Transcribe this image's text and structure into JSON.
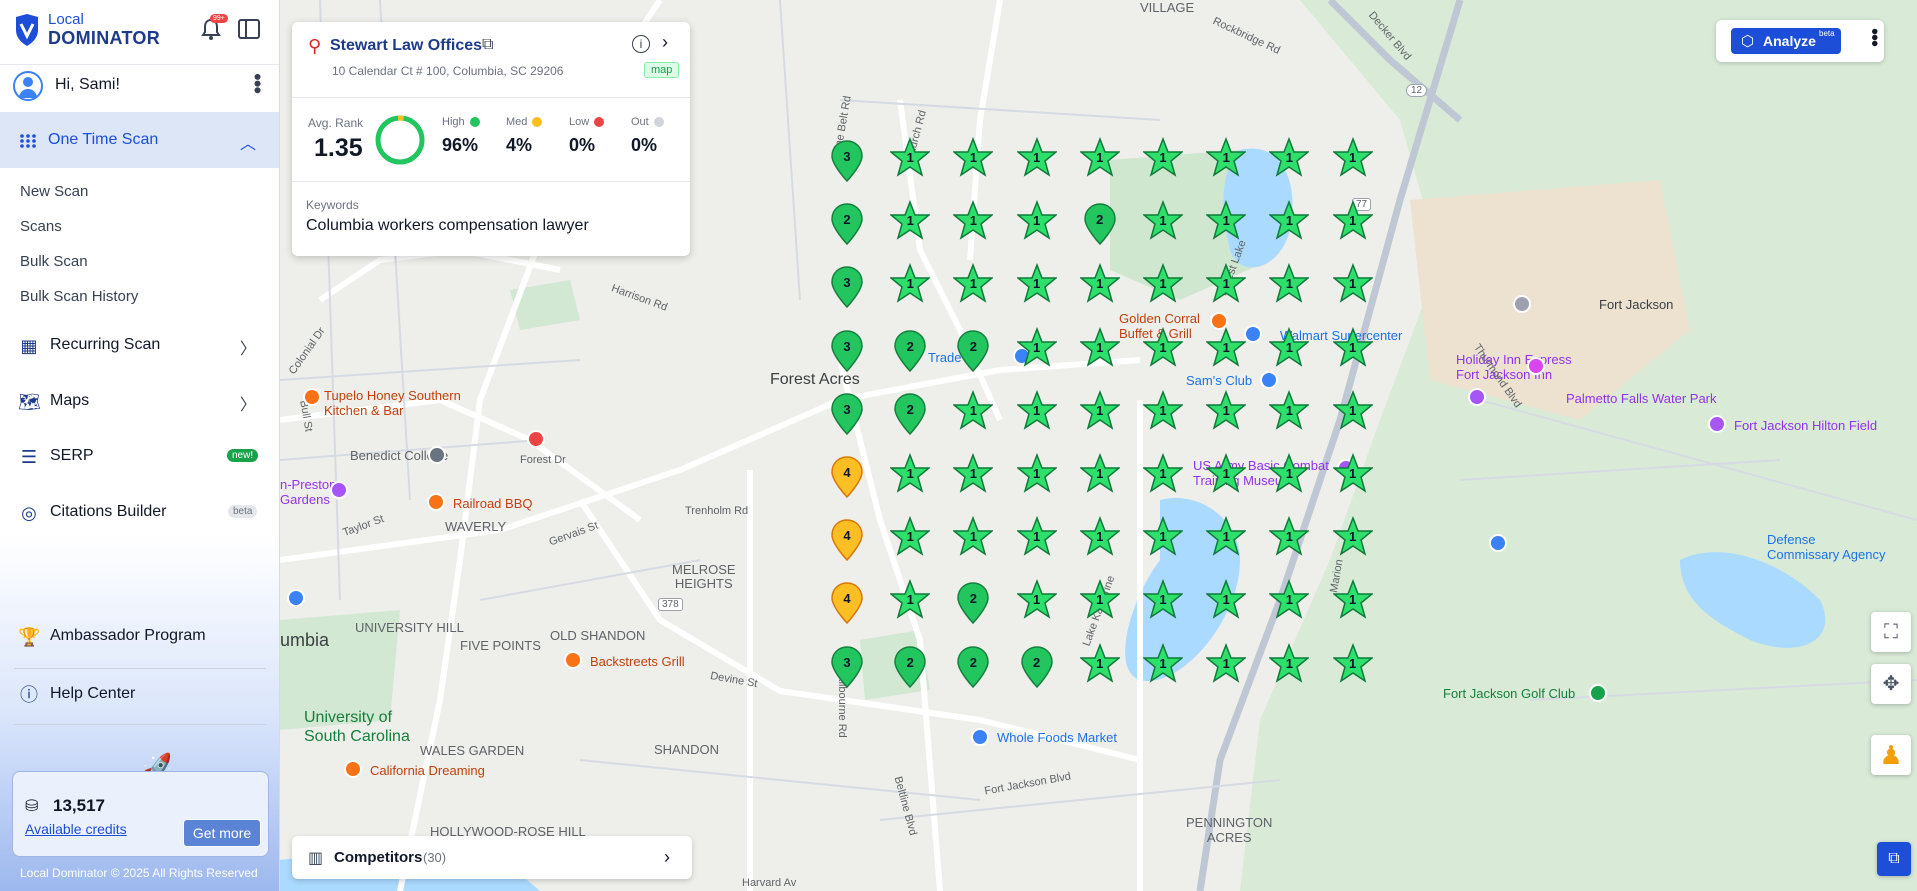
{
  "brand": {
    "line1": "Local",
    "line2": "DOMINATOR",
    "notif_badge": "99+"
  },
  "user": {
    "greeting": "Hi, Sami!"
  },
  "nav": {
    "one_time_scan": "One Time Scan",
    "sub_items": [
      "New Scan",
      "Scans",
      "Bulk Scan",
      "Bulk Scan History"
    ],
    "recurring_scan": "Recurring Scan",
    "maps": "Maps",
    "serp": "SERP",
    "serp_badge": "new!",
    "citations": "Citations Builder",
    "citations_badge": "beta",
    "ambassador": "Ambassador Program",
    "help": "Help Center"
  },
  "credits": {
    "amount": "13,517",
    "label": "Available credits",
    "button": "Get more"
  },
  "footer": {
    "copyright": "Local Dominator © 2025 All Rights Reserved"
  },
  "card": {
    "business": "Stewart Law Offices",
    "address": "10 Calendar Ct # 100, Columbia, SC 29206",
    "tag": "map",
    "avg_label": "Avg. Rank",
    "avg_value": "1.35",
    "stats": [
      {
        "label": "High",
        "value": "96%",
        "color": "#22c55e"
      },
      {
        "label": "Med",
        "value": "4%",
        "color": "#fbbf24"
      },
      {
        "label": "Low",
        "value": "0%",
        "color": "#ef4444"
      },
      {
        "label": "Out",
        "value": "0%",
        "color": "#d1d5db"
      }
    ],
    "keywords_label": "Keywords",
    "keyword": "Columbia workers compensation lawyer"
  },
  "competitors": {
    "label": "Competitors",
    "count": "(30)"
  },
  "analyze": {
    "label": "Analyze",
    "badge": "beta"
  },
  "grid": {
    "rows": [
      [
        "3",
        "1*",
        "1*",
        "1*",
        "1*",
        "1*",
        "1*",
        "1*",
        "1*"
      ],
      [
        "2",
        "1*",
        "1*",
        "1*",
        "2",
        "1*",
        "1*",
        "1*",
        "1*"
      ],
      [
        "3",
        "1*",
        "1*",
        "1*",
        "1*",
        "1*",
        "1*",
        "1*",
        "1*"
      ],
      [
        "3",
        "2",
        "2",
        "1*",
        "1*",
        "1*",
        "1*",
        "1*",
        "1*"
      ],
      [
        "3",
        "2",
        "1*",
        "1*",
        "1*",
        "1*",
        "1*",
        "1*",
        "1*"
      ],
      [
        "4",
        "1*",
        "1*",
        "1*",
        "1*",
        "1*",
        "1*",
        "1*",
        "1*"
      ],
      [
        "4",
        "1*",
        "1*",
        "1*",
        "1*",
        "1*",
        "1*",
        "1*",
        "1*"
      ],
      [
        "4",
        "1*",
        "2",
        "1*",
        "1*",
        "1*",
        "1*",
        "1*",
        "1*"
      ],
      [
        "3",
        "2",
        "2",
        "2",
        "1*",
        "1*",
        "1*",
        "1*",
        "1*"
      ]
    ]
  },
  "map_labels": {
    "village": "VILLAGE",
    "forest_acres": "Forest Acres",
    "waverly": "WAVERLY",
    "melrose": "MELROSE\nHEIGHTS",
    "university_hill": "UNIVERSITY HILL",
    "five_points": "FIVE POINTS",
    "old_shandon": "OLD SHANDON",
    "columbia": "umbia",
    "usc": "University of\nSouth Carolina",
    "wales_garden": "WALES GARDEN",
    "shandon": "SHANDON",
    "hollywood_rose_hill": "HOLLYWOOD-ROSE HILL",
    "pennington_acres": "PENNINGTON\nACRES",
    "fort_jackson": "Fort Jackson",
    "holiday_inn": "Holiday Inn Express\nFort Jackson Inn",
    "palmetto_falls": "Palmetto Falls Water Park",
    "fort_jackson_hilton": "Fort Jackson Hilton Field",
    "defense_commissary": "Defense\nCommissary Agency",
    "fort_jackson_golf": "Fort Jackson Golf Club",
    "walmart": "Walmart Supercenter",
    "sams_club": "Sam's Club",
    "golden_corral": "Golden Corral\nBuffet & Grill",
    "us_army": "US Army Basic Combat\nTraining Museum",
    "tupelo": "Tupelo Honey Southern\nKitchen & Bar",
    "benedict": "Benedict College",
    "railroad_bbq": "Railroad BBQ",
    "preston_gardens": "n-Preston\nGardens",
    "backstreets": "Backstreets Grill",
    "whole_foods": "Whole Foods Market",
    "california_dreaming": "California Dreaming",
    "trader": "Trade",
    "forest_dr": "Forest Dr",
    "trenholm_rd": "Trenholm Rd",
    "harrison_rd": "Harrison Rd",
    "gervais_st": "Gervais St",
    "devine_st": "Devine St",
    "kilbourne_rd": "Kilbourne Rd",
    "fort_jackson_blvd": "Fort Jackson Blvd",
    "beltline_blvd": "Beltline Blvd",
    "harvard_av": "Harvard Av",
    "rockbridge_rd": "Rockbridge Rd",
    "decker_blvd": "Decker Blvd",
    "pine_belt_rd": "Pine Belt Rd",
    "thurmond_blvd": "Thurmond Blvd",
    "taylor_st": "Taylor St",
    "bull_st": "Bull St",
    "colonial_dr": "Colonial Dr",
    "church_rd": "Church Rd",
    "forest_lake": "Forest Lake",
    "lake_katherine": "Lake Katherine",
    "marion": "Marion",
    "hwy12": "12",
    "hwy77": "77",
    "hwy378": "378"
  }
}
